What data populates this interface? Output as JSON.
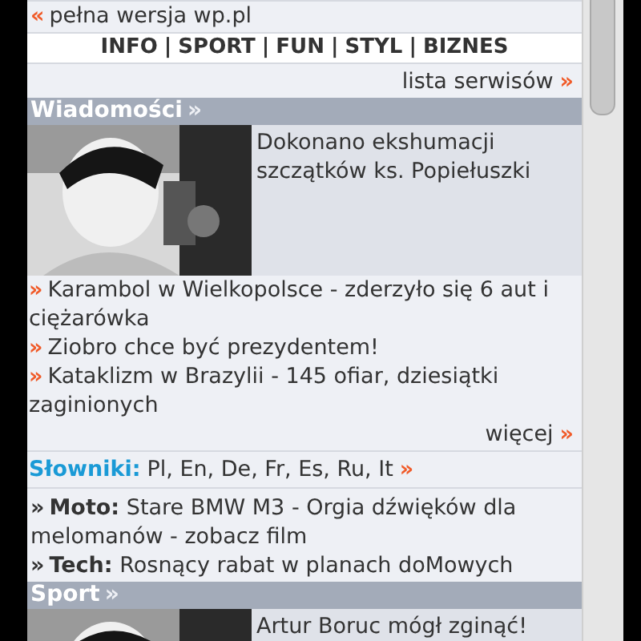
{
  "back_link": {
    "marker": "«",
    "label": "pełna wersja wp.pl"
  },
  "nav": {
    "separator": "|",
    "items": [
      "INFO",
      "SPORT",
      "FUN",
      "STYL",
      "BIZNES"
    ]
  },
  "services_link": {
    "label": "lista serwisów",
    "marker": "»"
  },
  "sections": [
    {
      "title": "Wiadomości",
      "marker": "»",
      "lead": {
        "kind": "picture",
        "headline": "Dokonano ekshumacji szczątków ks. Popiełuszki"
      },
      "items": [
        {
          "marker": "»",
          "text": "Karambol w Wielkopolsce - zderzyło się 6 aut i ciężarówka"
        },
        {
          "marker": "»",
          "text": "Ziobro chce być prezydentem!"
        },
        {
          "marker": "»",
          "text": "Kataklizm w Brazylii - 145 ofiar, dziesiątki zaginionych"
        }
      ],
      "more": {
        "label": "więcej",
        "marker": "»"
      },
      "dictionaries": {
        "label": "Słowniki:",
        "languages": "Pl, En, De, Fr, Es, Ru, It",
        "marker": "»"
      },
      "topics": [
        {
          "marker": "»",
          "category": "Moto:",
          "text": "Stare BMW M3 - Orgia dźwięków dla melomanów - zobacz film"
        },
        {
          "marker": "»",
          "category": "Tech:",
          "text": "Rosnący rabat w planach doMowych"
        }
      ]
    },
    {
      "title": "Sport",
      "marker": "»",
      "lead": {
        "kind": "picture",
        "headline": "Artur Boruc mógł zginąć!"
      }
    }
  ]
}
